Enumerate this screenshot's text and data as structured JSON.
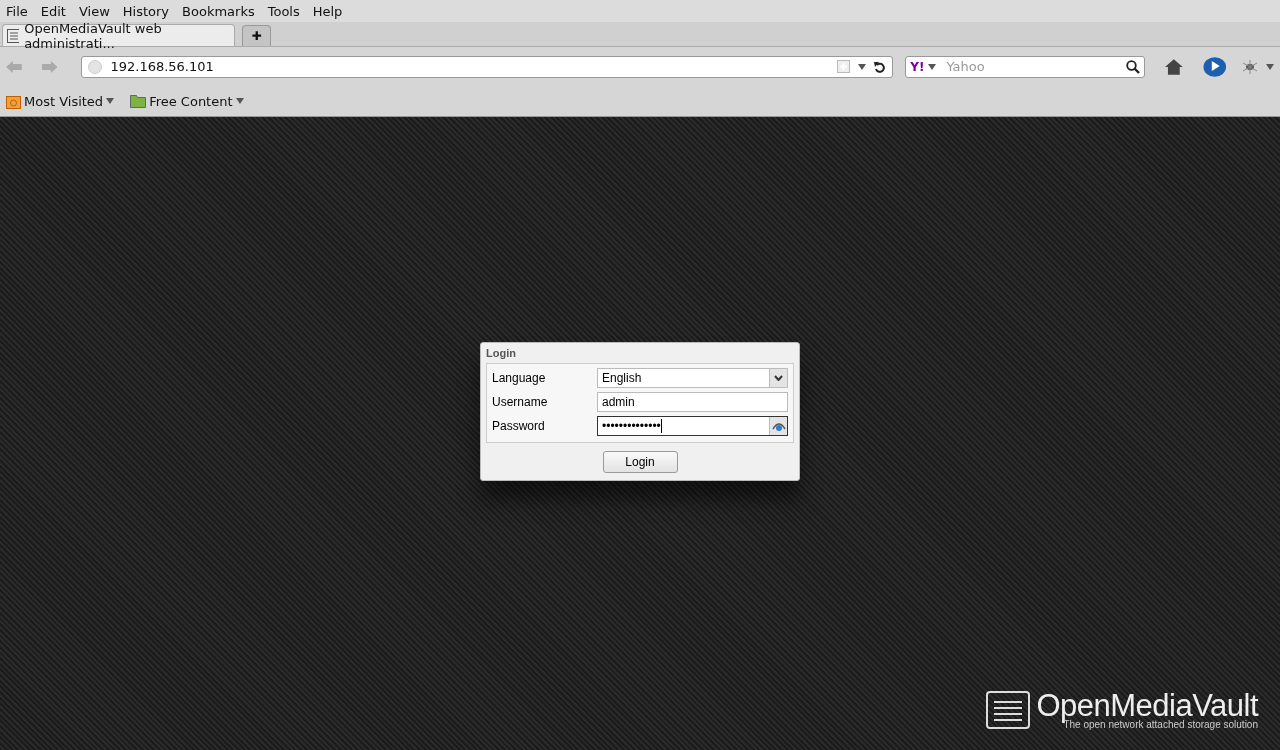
{
  "menu": [
    "File",
    "Edit",
    "View",
    "History",
    "Bookmarks",
    "Tools",
    "Help"
  ],
  "tabs": [
    {
      "label": "OpenMediaVault web administrati...",
      "selected": true
    }
  ],
  "new_tab": "✚",
  "address_bar": {
    "value": "192.168.56.101"
  },
  "search": {
    "engine": "Y!",
    "placeholder": "Yahoo"
  },
  "bookmarks": [
    {
      "label": "Most Visited",
      "kind": "smart"
    },
    {
      "label": "Free Content",
      "kind": "folder"
    }
  ],
  "login": {
    "title": "Login",
    "fields": [
      {
        "label": "Language",
        "kind": "select",
        "value": "English"
      },
      {
        "label": "Username",
        "kind": "text",
        "value": "admin"
      },
      {
        "label": "Password",
        "kind": "password",
        "value": "••••••••••••••"
      }
    ],
    "button": "Login"
  },
  "logo": {
    "name": "OpenMediaVault",
    "tagline": "The open network attached storage solution"
  }
}
